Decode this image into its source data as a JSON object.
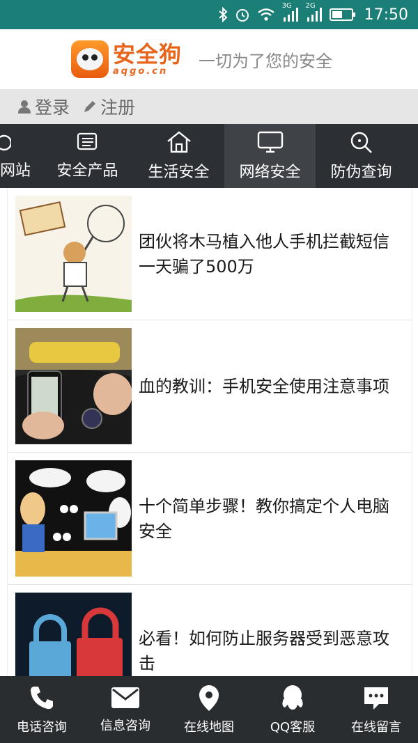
{
  "status_bar": {
    "network_3g": "3G",
    "network_2g": "2G",
    "time": "17:50",
    "icons": [
      "bluetooth-icon",
      "alarm-icon",
      "wifi-icon",
      "signal-3g-icon",
      "signal-2g-icon",
      "battery-icon"
    ]
  },
  "header": {
    "logo_cn": "安全狗",
    "logo_en": "aqgo.cn",
    "slogan": "一切为了您的安全"
  },
  "login_bar": {
    "login_label": "登录",
    "register_label": "注册"
  },
  "nav": {
    "items": [
      {
        "label": "网站",
        "icon": "refresh-icon"
      },
      {
        "label": "安全产品",
        "icon": "list-icon"
      },
      {
        "label": "生活安全",
        "icon": "home-icon"
      },
      {
        "label": "网络安全",
        "icon": "monitor-icon",
        "active": true
      },
      {
        "label": "防伪查询",
        "icon": "search-icon"
      }
    ]
  },
  "articles": [
    {
      "title": "团伙将木马植入他人手机拦截短信 一天骗了500万"
    },
    {
      "title": "血的教训：手机安全使用注意事项"
    },
    {
      "title": "十个简单步骤！教你搞定个人电脑安全"
    },
    {
      "title": "必看！如何防止服务器受到恶意攻击"
    }
  ],
  "bottom_bar": {
    "items": [
      {
        "label": "电话咨询",
        "icon": "phone-icon"
      },
      {
        "label": "信息咨询",
        "icon": "mail-icon"
      },
      {
        "label": "在线地图",
        "icon": "map-pin-icon"
      },
      {
        "label": "QQ客服",
        "icon": "qq-icon"
      },
      {
        "label": "在线留言",
        "icon": "chat-icon"
      }
    ]
  },
  "colors": {
    "status_bar": "#1b7f78",
    "nav_bg": "#2c2f33",
    "nav_active": "#3f4347",
    "brand": "#e8641a",
    "bottom_bar": "#2a2d30"
  }
}
